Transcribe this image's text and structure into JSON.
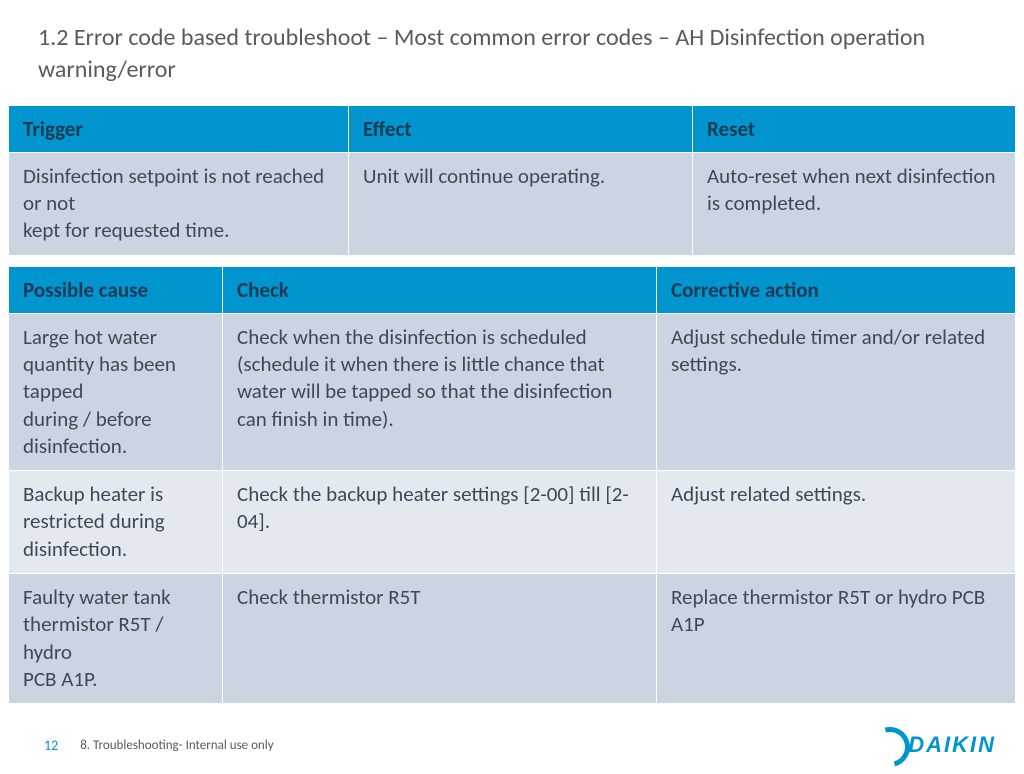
{
  "title": "1.2 Error code based troubleshoot –  Most common error codes – AH Disinfection operation warning/error",
  "table1": {
    "headers": [
      "Trigger",
      "Effect",
      "Reset"
    ],
    "row": [
      "Disinfection setpoint is not reached or not\nkept for requested time.",
      "Unit will continue operating.",
      "Auto-reset when next disinfection is completed."
    ]
  },
  "table2": {
    "headers": [
      "Possible cause",
      "Check",
      "Corrective action"
    ],
    "rows": [
      [
        "Large hot water quantity has been tapped\nduring / before disinfection.",
        "Check when the disinfection is scheduled (schedule it when there is little chance that water will be tapped so that the disinfection\ncan finish in time).",
        "Adjust schedule timer and/or related settings."
      ],
      [
        "Backup heater is restricted during disinfection.",
        "Check the backup heater settings [2-00] till [2-04].",
        "Adjust related settings."
      ],
      [
        "Faulty water tank thermistor R5T / hydro\nPCB A1P.",
        "Check thermistor R5T",
        "Replace thermistor R5T or hydro PCB A1P"
      ]
    ]
  },
  "footer": {
    "page": "12",
    "section": "8. Troubleshooting- Internal use only",
    "logo": "DAIKIN"
  }
}
